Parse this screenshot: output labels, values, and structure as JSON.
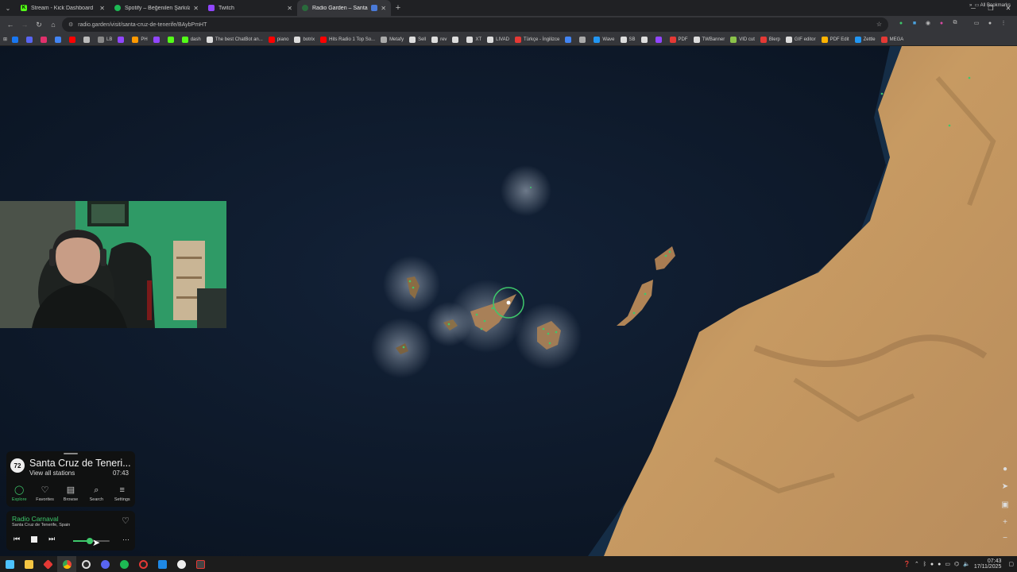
{
  "browser": {
    "tabs": [
      {
        "title": "Stream - Kick Dashboard",
        "color": "#53fc18",
        "glyph": "K",
        "active": false
      },
      {
        "title": "Spotify – Beğenilen Şarkılar",
        "color": "#1db954",
        "glyph": "",
        "active": false
      },
      {
        "title": "Twitch",
        "color": "#9146ff",
        "glyph": "",
        "active": false
      },
      {
        "title": "Radio Garden – Santa Cruz",
        "color": "#2a6b3c",
        "glyph": "",
        "active": true
      }
    ],
    "url": "radio.garden/visit/santa-cruz-de-tenerife/BAybPmHT",
    "bookmarks": [
      {
        "label": "",
        "color": "#1877f2"
      },
      {
        "label": "",
        "color": "#5865f2"
      },
      {
        "label": "",
        "color": "#e1306c"
      },
      {
        "label": "",
        "color": "#4285f4"
      },
      {
        "label": "",
        "color": "#ff0000"
      },
      {
        "label": "",
        "color": "#bbbbbb"
      },
      {
        "label": "LB",
        "color": "#888888"
      },
      {
        "label": "",
        "color": "#9146ff"
      },
      {
        "label": "PH",
        "color": "#ff9900"
      },
      {
        "label": "",
        "color": "#9146ff"
      },
      {
        "label": "",
        "color": "#53fc18"
      },
      {
        "label": "dash",
        "color": "#53fc18"
      },
      {
        "label": "The best ChatBot an...",
        "color": "#dddddd"
      },
      {
        "label": "piano",
        "color": "#ff0000"
      },
      {
        "label": "botrix",
        "color": "#dddddd"
      },
      {
        "label": "Hits Radio 1 Top So...",
        "color": "#ff0000"
      },
      {
        "label": "Metafy",
        "color": "#aaaaaa"
      },
      {
        "label": "Sell",
        "color": "#dddddd"
      },
      {
        "label": "rev",
        "color": "#dddddd"
      },
      {
        "label": "",
        "color": "#dddddd"
      },
      {
        "label": "XT",
        "color": "#dddddd"
      },
      {
        "label": "LIVAD",
        "color": "#dddddd"
      },
      {
        "label": "Türkçe - İngilizce",
        "color": "#e53935"
      },
      {
        "label": "",
        "color": "#4285f4"
      },
      {
        "label": "",
        "color": "#aaaaaa"
      },
      {
        "label": "Wave",
        "color": "#2196f3"
      },
      {
        "label": "SB",
        "color": "#dddddd"
      },
      {
        "label": "",
        "color": "#dddddd"
      },
      {
        "label": "",
        "color": "#9146ff"
      },
      {
        "label": "PDF",
        "color": "#e53935"
      },
      {
        "label": "TWBanner",
        "color": "#dddddd"
      },
      {
        "label": "VID cut",
        "color": "#8bc34a"
      },
      {
        "label": "Blerp",
        "color": "#e53935"
      },
      {
        "label": "GIF editor",
        "color": "#dddddd"
      },
      {
        "label": "PDF Edit",
        "color": "#ffb300"
      },
      {
        "label": "Zettle",
        "color": "#2196f3"
      },
      {
        "label": "MEGA",
        "color": "#e53935"
      }
    ],
    "all_bookmarks": "All Bookmarks"
  },
  "radio": {
    "logo": "72",
    "place_title": "Santa Cruz de Teneri...",
    "view_all": "View all stations",
    "local_time": "07:43",
    "nav": [
      {
        "label": "Explore",
        "icon": "explore-icon",
        "glyph": "◯",
        "active": true
      },
      {
        "label": "Favorites",
        "icon": "heart-icon",
        "glyph": "♡",
        "active": false
      },
      {
        "label": "Browse",
        "icon": "map-icon",
        "glyph": "▤",
        "active": false
      },
      {
        "label": "Search",
        "icon": "search-icon",
        "glyph": "⌕",
        "active": false
      },
      {
        "label": "Settings",
        "icon": "menu-icon",
        "glyph": "≡",
        "active": false
      }
    ],
    "station_name": "Radio Carnaval",
    "station_location": "Santa Cruz de Tenerife, Spain",
    "volume": 0.45
  },
  "map": {
    "accent": "#3ec86b",
    "ocean": "#0b1524"
  },
  "taskbar": {
    "time": "07:43",
    "date": "17/11/2025"
  }
}
